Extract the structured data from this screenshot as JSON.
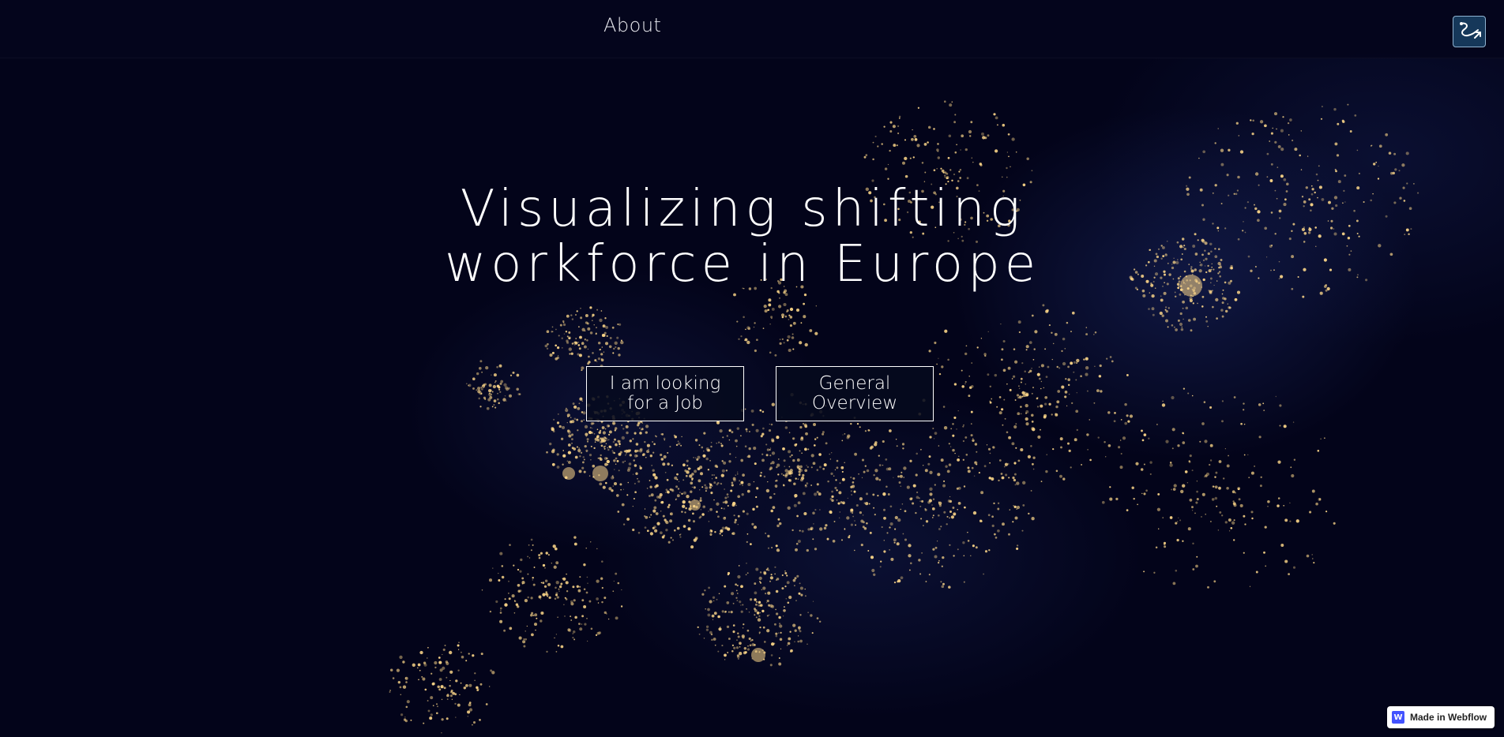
{
  "nav": {
    "about_label": "About",
    "logo_icon": "route-logo-icon"
  },
  "hero": {
    "title_line1": "Visualizing shifting",
    "title_line2": "workforce in Europe"
  },
  "actions": {
    "job_label": "I am looking for a Job",
    "overview_label": "General Overview"
  },
  "badge": {
    "label": "Made in Webflow",
    "logo_letter": "W"
  },
  "colors": {
    "background": "#03041a",
    "text": "#ffffff",
    "city_lights": "#ffd98a",
    "logo_fill": "#16385a",
    "webflow_brand": "#4353ff"
  }
}
